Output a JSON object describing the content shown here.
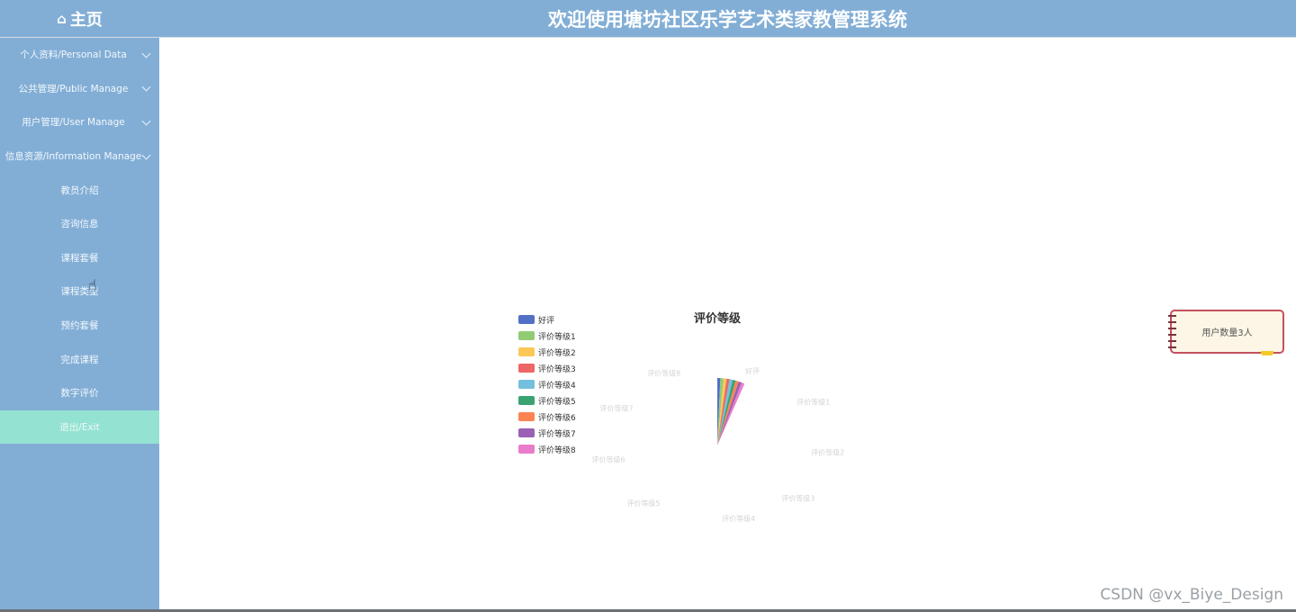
{
  "header": {
    "home_icon": "⌂",
    "home_label": "主页",
    "title": "欢迎使用塘坊社区乐学艺术类家教管理系统"
  },
  "sidebar": {
    "items": [
      {
        "label": "个人资料/Personal Data",
        "expandable": true
      },
      {
        "label": "公共管理/Public Manage",
        "expandable": true
      },
      {
        "label": "用户管理/User Manage",
        "expandable": true
      },
      {
        "label": "信息资源/Information Manage",
        "expandable": true
      },
      {
        "label": "教员介绍",
        "expandable": false
      },
      {
        "label": "咨询信息",
        "expandable": false
      },
      {
        "label": "课程套餐",
        "expandable": false
      },
      {
        "label": "课程类型",
        "expandable": false
      },
      {
        "label": "预约套餐",
        "expandable": false
      },
      {
        "label": "完成课程",
        "expandable": false
      },
      {
        "label": "数字评价",
        "expandable": false
      },
      {
        "label": "退出/Exit",
        "expandable": false,
        "active": true
      }
    ]
  },
  "chart_data": {
    "type": "pie",
    "title": "评价等级",
    "legend_position": "top-left",
    "categories": [
      "好评",
      "评价等级1",
      "评价等级2",
      "评价等级3",
      "评价等级4",
      "评价等级5",
      "评价等级6",
      "评价等级7",
      "评价等级8"
    ],
    "values": [
      1,
      1,
      1,
      1,
      1,
      1,
      1,
      1,
      1
    ],
    "colors": [
      "#5470c6",
      "#91cc75",
      "#fac858",
      "#ee6666",
      "#73c0de",
      "#3ba272",
      "#fc8452",
      "#9a60b4",
      "#ea7ccc"
    ]
  },
  "note_card": {
    "text": "用户数量3人"
  },
  "watermark": "CSDN @vx_Biye_Design"
}
